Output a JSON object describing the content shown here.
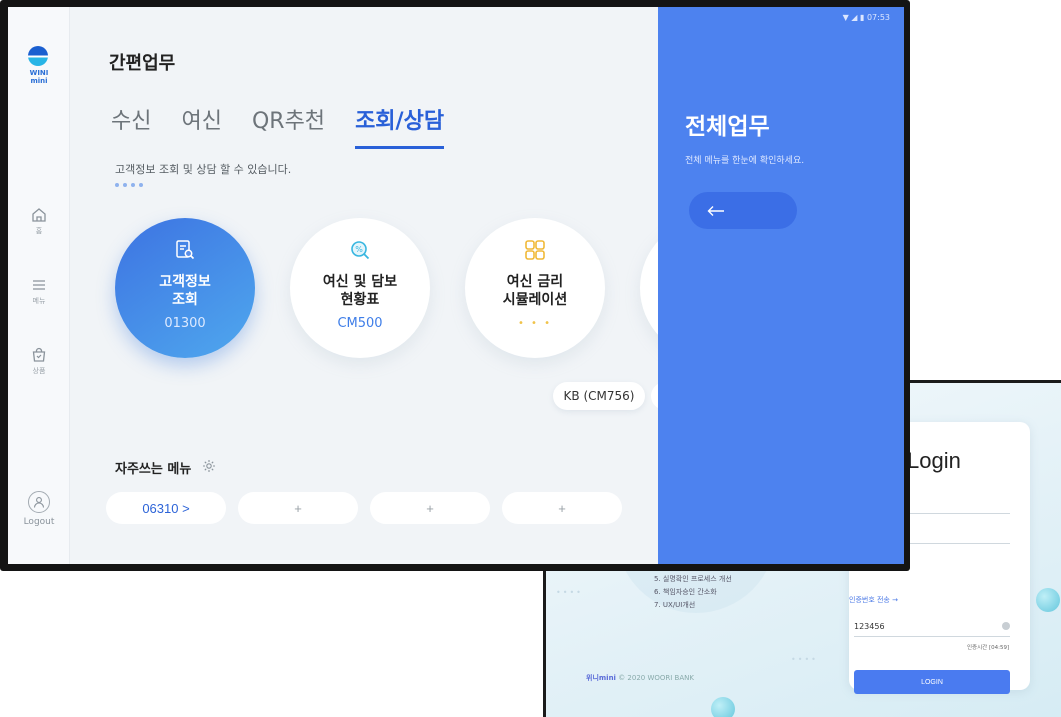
{
  "back_screen": {
    "login_title": "Login",
    "list_items": [
      "5. 실명확인 프로세스 개선",
      "6. 책임자승인 간소화",
      "7. UX/UI개선"
    ],
    "list_partial": "...",
    "cert_link": "인증번호 전송 →",
    "otp_value": "123456",
    "otp_timer": "인증시간 [04:59]",
    "login_button": "LOGIN",
    "brand": "위니mini",
    "copyright": "© 2020 WOORI BANK"
  },
  "status_bar": {
    "time": "▼ ◢ ▮ 07:53"
  },
  "side_rail": {
    "logo_top": "WINI",
    "logo_bottom": "mini",
    "items": [
      {
        "label": "홈",
        "icon": "home-icon"
      },
      {
        "label": "메뉴",
        "icon": "menu-icon"
      },
      {
        "label": "상품",
        "icon": "bag-icon"
      }
    ],
    "logout_label": "Logout"
  },
  "main": {
    "title": "간편업무",
    "tabs": [
      {
        "label": "수신",
        "active": false
      },
      {
        "label": "여신",
        "active": false
      },
      {
        "label": "QR추천",
        "active": false
      },
      {
        "label": "조회/상담",
        "active": true
      }
    ],
    "subtitle": "고객정보 조회 및 상담 할 수 있습니다.",
    "cards": [
      {
        "title_line1": "고객정보",
        "title_line2": "조회",
        "code": "01300",
        "icon": "document-search-icon",
        "active": true
      },
      {
        "title_line1": "여신 및 담보",
        "title_line2": "현황표",
        "code": "CM500",
        "icon": "percent-search-icon",
        "active": false
      },
      {
        "title_line1": "여신 금리",
        "title_line2": "시뮬레이션",
        "code": "• • •",
        "icon": "calculator-icon",
        "active": false
      }
    ],
    "chip": "KB (CM756)",
    "favorites_title": "자주쓰는 메뉴",
    "favorites": [
      "06310 >",
      "+",
      "+",
      "+"
    ]
  },
  "right_panel": {
    "title": "전체업무",
    "subtitle": "전체 메뉴를 한눈에 확인하세요.",
    "back_arrow": "←"
  }
}
